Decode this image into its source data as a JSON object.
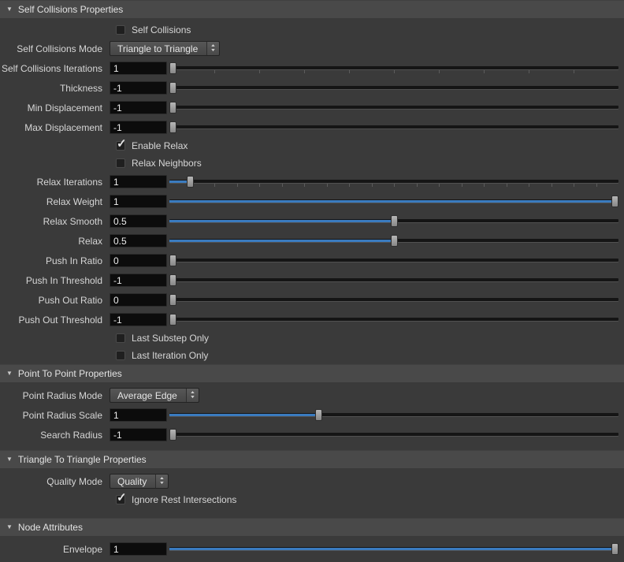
{
  "colors": {
    "accent_blue": "#3a7bbf",
    "header_bg": "#494949",
    "panel_bg": "#3a3a3a",
    "field_bg": "#0c0c0c"
  },
  "icons": {
    "collapse": "▼",
    "check": "✓",
    "spin_up": "▲",
    "spin_down": "▼"
  },
  "sections": [
    {
      "title": "Self Collisions Properties",
      "rows": [
        {
          "type": "checkbox",
          "label": "Self Collisions",
          "checked": false
        },
        {
          "type": "dropdown",
          "label": "Self Collisions Mode",
          "option": "Triangle to Triangle"
        },
        {
          "type": "slider",
          "label": "Self Collisions Iterations",
          "value": "1",
          "fraction": 0,
          "ticks": 10
        },
        {
          "type": "slider",
          "label": "Thickness",
          "value": "-1",
          "fraction": 0
        },
        {
          "type": "slider",
          "label": "Min Displacement",
          "value": "-1",
          "fraction": 0
        },
        {
          "type": "slider",
          "label": "Max Displacement",
          "value": "-1",
          "fraction": 0
        },
        {
          "type": "checkbox",
          "label": "Enable Relax",
          "checked": true
        },
        {
          "type": "checkbox",
          "label": "Relax Neighbors",
          "checked": false
        },
        {
          "type": "slider",
          "label": "Relax Iterations",
          "value": "1",
          "fraction": 0.04,
          "ticks": 20
        },
        {
          "type": "slider",
          "label": "Relax Weight",
          "value": "1",
          "fraction": 1
        },
        {
          "type": "slider",
          "label": "Relax Smooth",
          "value": "0.5",
          "fraction": 0.5
        },
        {
          "type": "slider",
          "label": "Relax",
          "value": "0.5",
          "fraction": 0.5
        },
        {
          "type": "slider",
          "label": "Push In Ratio",
          "value": "0",
          "fraction": 0
        },
        {
          "type": "slider",
          "label": "Push In Threshold",
          "value": "-1",
          "fraction": 0
        },
        {
          "type": "slider",
          "label": "Push Out Ratio",
          "value": "0",
          "fraction": 0
        },
        {
          "type": "slider",
          "label": "Push Out Threshold",
          "value": "-1",
          "fraction": 0
        },
        {
          "type": "checkbox",
          "label": "Last Substep Only",
          "checked": false
        },
        {
          "type": "checkbox",
          "label": "Last Iteration Only",
          "checked": false
        }
      ]
    },
    {
      "title": "Point To Point Properties",
      "rows": [
        {
          "type": "dropdown",
          "label": "Point Radius Mode",
          "option": "Average Edge"
        },
        {
          "type": "slider",
          "label": "Point Radius Scale",
          "value": "1",
          "fraction": 0.33
        },
        {
          "type": "slider",
          "label": "Search Radius",
          "value": "-1",
          "fraction": 0
        }
      ]
    },
    {
      "title": "Triangle To Triangle Properties",
      "rows": [
        {
          "type": "dropdown",
          "label": "Quality Mode",
          "option": "Quality"
        },
        {
          "type": "checkbox",
          "label": "Ignore Rest Intersections",
          "checked": true
        }
      ]
    },
    {
      "title": "Node Attributes",
      "rows": [
        {
          "type": "slider",
          "label": "Envelope",
          "value": "1",
          "fraction": 1
        }
      ]
    }
  ]
}
